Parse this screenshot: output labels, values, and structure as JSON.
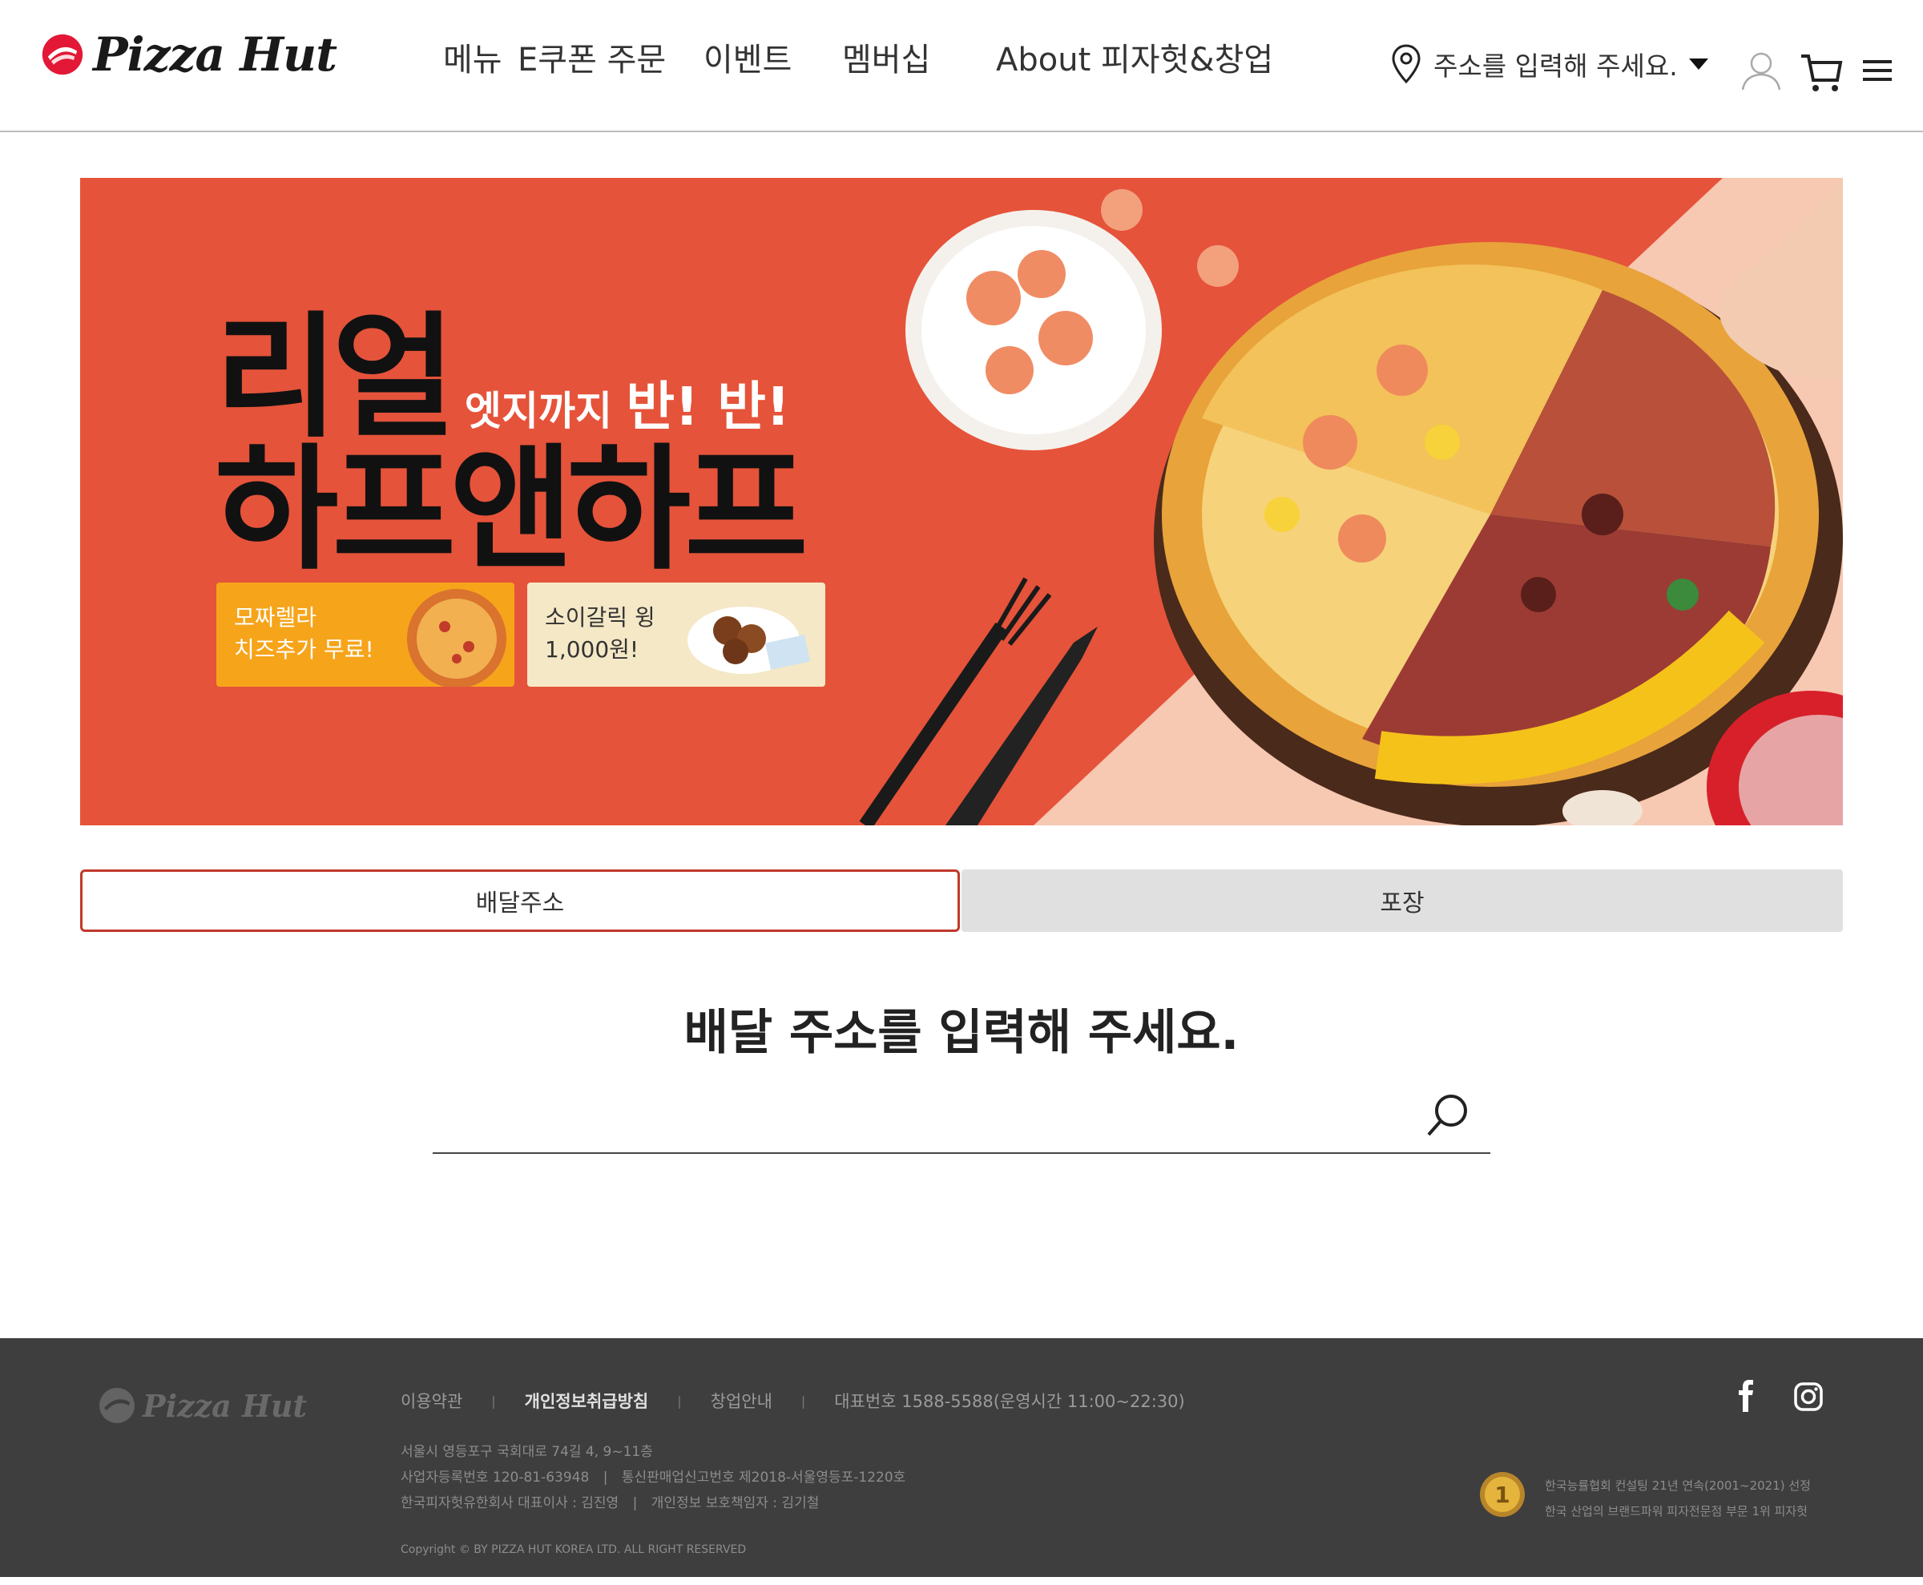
{
  "header": {
    "logo_text": "Pizza Hut",
    "nav": [
      "메뉴",
      "E쿠폰 주문",
      "이벤트",
      "멤버십",
      "About 피자헛&창업"
    ],
    "address_prompt": "주소를 입력해 주세요."
  },
  "banner": {
    "headline_1": "리얼",
    "subline_prefix": "엣지까지",
    "subline_emphasis": "반! 반!",
    "headline_2": "하프앤하프",
    "promo_1": "모짜렐라\n치즈추가 무료!",
    "promo_2": "소이갈릭 윙\n1,000원!"
  },
  "tabs": {
    "delivery": "배달주소",
    "pickup": "포장"
  },
  "main": {
    "prompt_title": "배달 주소를 입력해 주세요.",
    "search_value": ""
  },
  "footer": {
    "logo_text": "Pizza Hut",
    "links": {
      "terms": "이용약관",
      "privacy": "개인정보취급방침",
      "franchise": "창업안내",
      "phone": "대표번호 1588-5588(운영시간 11:00~22:30)"
    },
    "address": "서울시 영등포구 국회대로 74길 4, 9~11층",
    "business_reg": "사업자등록번호 120-81-63948",
    "ecommerce_reg": "통신판매업신고번호 제2018-서울영등포-1220호",
    "company_ceo": "한국피자헛유한회사 대표이사 : 김진영",
    "privacy_officer": "개인정보 보호책임자 : 김기철",
    "copyright": "Copyright © BY PIZZA HUT KOREA LTD. ALL RIGHT RESERVED",
    "award_badge": "1",
    "award_line_1": "한국능률협회 컨설팅 21년 연속(2001~2021) 선정",
    "award_line_2": "한국 산업의 브랜드파워 피자전문점 부문 1위 피자헛"
  },
  "colors": {
    "brand_red": "#e31837",
    "banner_red": "#e5533a",
    "active_tab_border": "#c1392b",
    "footer_bg": "#3e3e3e"
  },
  "icons": [
    "location-pin-icon",
    "caret-down-icon",
    "user-icon",
    "cart-icon",
    "menu-icon",
    "search-icon",
    "facebook-icon",
    "instagram-icon",
    "award-medal-icon"
  ]
}
